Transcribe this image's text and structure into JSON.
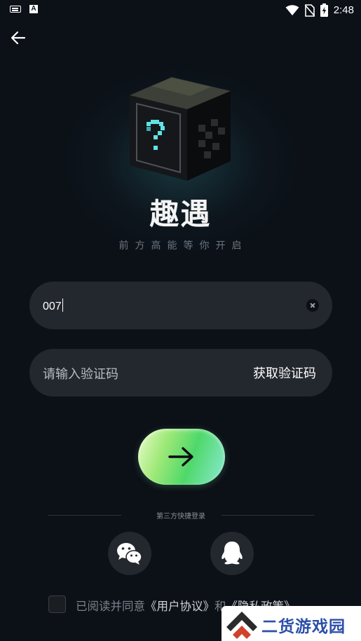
{
  "status_bar": {
    "time": "2:48",
    "keyboard_letter": "A",
    "icons": [
      "keyboard-icon",
      "font-icon",
      "wifi-icon",
      "no-sim-icon",
      "battery-charging-icon"
    ]
  },
  "nav": {
    "back_icon": "arrow-left-icon"
  },
  "brand": {
    "app_name": "趣遇",
    "slogan": "前方高能等你开启",
    "logo_icon": "mystery-box-icon"
  },
  "login_form": {
    "phone_value": "007",
    "clear_icon": "clear-icon",
    "code_placeholder": "请输入验证码",
    "get_code_label": "获取验证码",
    "submit_icon": "arrow-right-icon"
  },
  "third_party": {
    "label": "第三方快捷登录",
    "providers": [
      {
        "name": "wechat",
        "icon": "wechat-icon"
      },
      {
        "name": "qq",
        "icon": "qq-penguin-icon"
      }
    ]
  },
  "agreement": {
    "checked": false,
    "prefix": "已阅读并同意",
    "user_agreement": "《用户协议》",
    "connector": "和",
    "privacy_policy": "《隐私政策》"
  },
  "watermark": {
    "text": "二货游戏园",
    "icon": "double-chevron-up-icon"
  },
  "colors": {
    "background": "#0c1017",
    "field_bg": "#23272e",
    "accent_green": "#4fd86a",
    "accent_cyan": "#5fe3e6",
    "watermark_blue": "#2c4fa8"
  }
}
